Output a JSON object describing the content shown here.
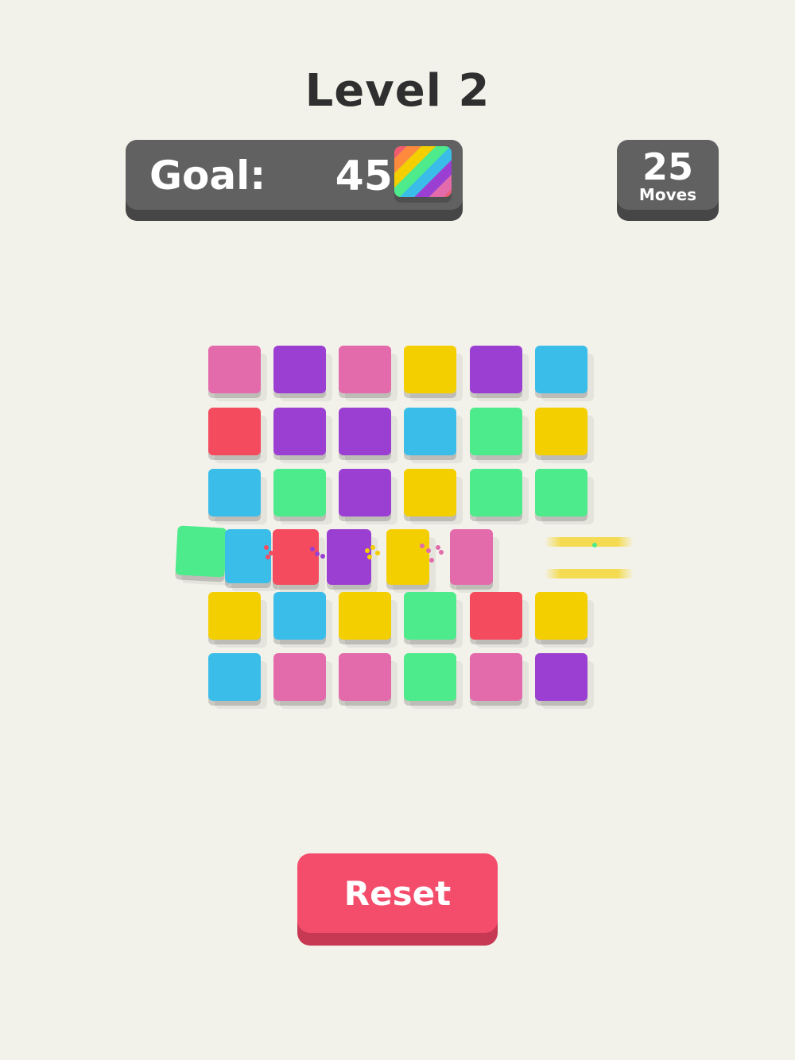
{
  "title": "Level 2",
  "goal": {
    "label": "Goal:",
    "value": "45",
    "icon": "rainbow-stripes-icon"
  },
  "moves": {
    "count": "25",
    "label": "Moves"
  },
  "colors": {
    "pink": "#e36aab",
    "purple": "#9a3fd2",
    "yellow": "#f4cf00",
    "blue": "#3bbde9",
    "red": "#f44b5e",
    "green": "#4deb8b"
  },
  "grid": [
    [
      "pink",
      "purple",
      "pink",
      "yellow",
      "purple",
      "blue"
    ],
    [
      "red",
      "purple",
      "purple",
      "blue",
      "green",
      "yellow"
    ],
    [
      "blue",
      "green",
      "purple",
      "yellow",
      "green",
      "green"
    ],
    [
      "green",
      "blue",
      "red",
      "purple",
      "yellow",
      "pink"
    ],
    [
      "yellow",
      "blue",
      "yellow",
      "green",
      "red",
      "yellow"
    ],
    [
      "blue",
      "pink",
      "pink",
      "green",
      "pink",
      "purple"
    ]
  ],
  "reset_label": "Reset"
}
